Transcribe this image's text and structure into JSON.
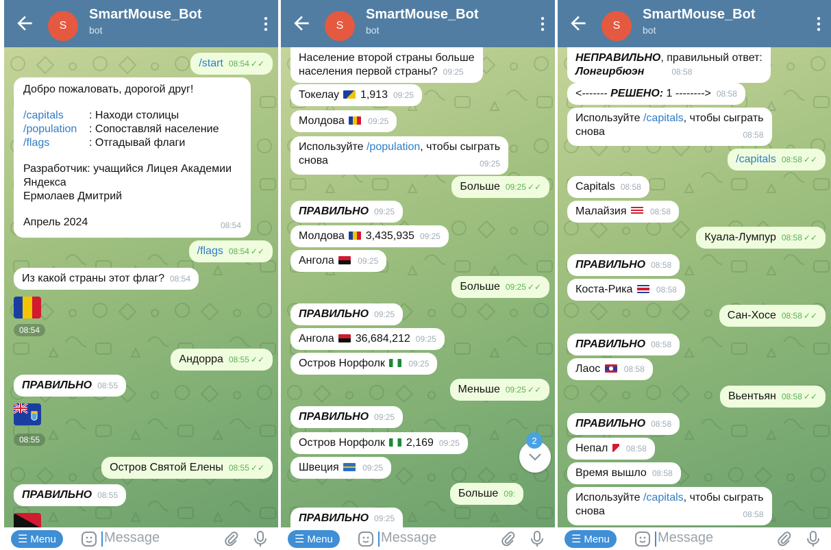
{
  "chat": {
    "title": "SmartMouse_Bot",
    "subtitle": "bot",
    "avatar_letter": "S"
  },
  "input": {
    "menu_label": "Menu",
    "placeholder": "Message",
    "badge": "2"
  },
  "colors": {
    "header": "#517da2",
    "outgoing": "#effdde",
    "link": "#2f7cc7",
    "check": "#5fae57"
  },
  "panel1": {
    "start": {
      "text": "/start",
      "time": "08:54"
    },
    "welcome": {
      "greeting": "Добро пожаловать, дорогой друг!",
      "cmd1": "/capitals",
      "desc1": ": Находи столицы",
      "cmd2": "/population",
      "desc2": ": Сопоставляй население",
      "cmd3": "/flags",
      "desc3": ": Отгадывай флаги",
      "dev1": "Разработчик: учащийся Лицея Академии",
      "dev2": "Яндекса",
      "dev3": "Ермолаев Дмитрий",
      "date": "Апрель 2024",
      "time": "08:54"
    },
    "flags": {
      "text": "/flags",
      "time": "08:54"
    },
    "question": {
      "text": "Из какой страны этот флаг?",
      "time": "08:54"
    },
    "flag1_time": "08:54",
    "answer1": {
      "text": "Андорра",
      "time": "08:55"
    },
    "correct1": {
      "text": "ПРАВИЛЬНО",
      "time": "08:55"
    },
    "flag2_time": "08:55",
    "answer2": {
      "text": "Остров Святой Елены",
      "time": "08:55"
    },
    "correct2": {
      "text": "ПРАВИЛЬНО",
      "time": "08:55"
    }
  },
  "panel2": {
    "q1": "Население второй страны больше",
    "q2": "населения первой страны?",
    "q_time": "09:25",
    "tokelau": {
      "name": "Токелау",
      "value": "1,913",
      "time": "09:25"
    },
    "moldova": {
      "name": "Молдова",
      "time": "09:25"
    },
    "use1": "Используйте ",
    "use_cmd": "/population",
    "use2": ", чтобы сыграть",
    "use3": "снова",
    "use_time": "09:25",
    "more1": {
      "text": "Больше",
      "time": "09:25"
    },
    "correct1": {
      "text": "ПРАВИЛЬНО",
      "time": "09:25"
    },
    "moldova2": {
      "name": "Молдова",
      "value": "3,435,935",
      "time": "09:25"
    },
    "angola": {
      "name": "Ангола",
      "time": "09:25"
    },
    "more2": {
      "text": "Больше",
      "time": "09:25"
    },
    "correct2": {
      "text": "ПРАВИЛЬНО",
      "time": "09:25"
    },
    "angola2": {
      "name": "Ангола",
      "value": "36,684,212",
      "time": "09:25"
    },
    "norfolk": {
      "name": "Остров Норфолк",
      "time": "09:25"
    },
    "less": {
      "text": "Меньше",
      "time": "09:25"
    },
    "correct3": {
      "text": "ПРАВИЛЬНО",
      "time": "09:25"
    },
    "norfolk2": {
      "name": "Остров Норфолк",
      "value": "2,169",
      "time": "09:25"
    },
    "sweden": {
      "name": "Швеция",
      "time": "09:25"
    },
    "more3": {
      "text": "Больше",
      "time": "09:"
    },
    "correct4": {
      "text": "ПРАВИЛЬНО",
      "time": "09:25"
    }
  },
  "panel3": {
    "wrong1": "НЕПРАВИЛЬНО",
    "wrong2": ", правильный ответ:",
    "wrong_answer": "Лонгирбюэн",
    "wrong_time": "08:58",
    "solved_pre": "<------- ",
    "solved_label": "РЕШЕНО:",
    "solved_post": " 1 -------->",
    "solved_time": "08:58",
    "use1": "Используйте ",
    "use_cmd": "/capitals",
    "use2": ", чтобы сыграть",
    "use3": "снова",
    "use_time": "08:58",
    "capitals_cmd": {
      "text": "/capitals",
      "time": "08:58"
    },
    "capitals_lbl": {
      "text": "Capitals",
      "time": "08:58"
    },
    "malaysia": {
      "name": "Малайзия",
      "time": "08:58"
    },
    "kl": {
      "text": "Куала-Лумпур",
      "time": "08:58"
    },
    "correct1": {
      "text": "ПРАВИЛЬНО",
      "time": "08:58"
    },
    "costa": {
      "name": "Коста-Рика",
      "time": "08:58"
    },
    "sj": {
      "text": "Сан-Хосе",
      "time": "08:58"
    },
    "correct2": {
      "text": "ПРАВИЛЬНО",
      "time": "08:58"
    },
    "laos": {
      "name": "Лаос",
      "time": "08:58"
    },
    "vt": {
      "text": "Вьентьян",
      "time": "08:58"
    },
    "correct3": {
      "text": "ПРАВИЛЬНО",
      "time": "08:58"
    },
    "nepal": {
      "name": "Непал",
      "time": "08:58"
    },
    "timeout": {
      "text": "Время вышло",
      "time": "08:58"
    },
    "use_b1": "Используйте ",
    "use_b_cmd": "/capitals",
    "use_b2": ", чтобы сыграть",
    "use_b3": "снова",
    "use_b_time": "08:58"
  }
}
